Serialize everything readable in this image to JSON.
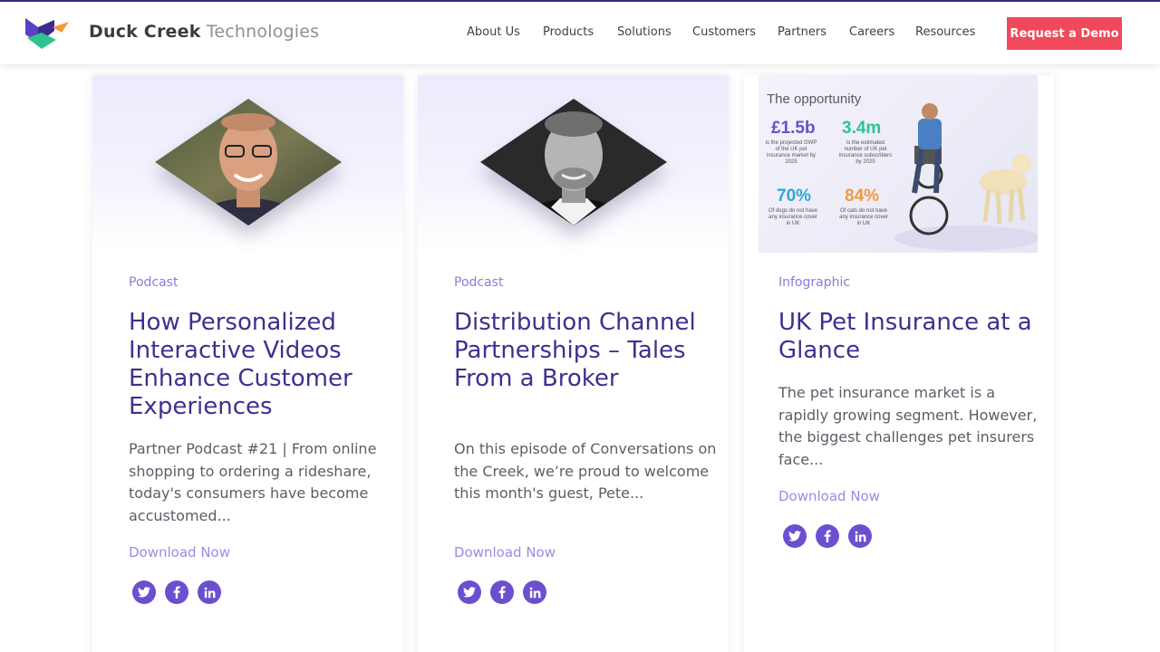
{
  "header": {
    "brand_main": "Duck Creek",
    "brand_sub": "Technologies",
    "nav": [
      "About Us",
      "Products",
      "Solutions",
      "Customers",
      "Partners",
      "Careers",
      "Resources"
    ],
    "cta": "Request a Demo"
  },
  "colors": {
    "accent": "#f0495a",
    "brand_purple": "#3d3190",
    "link": "#9a8de2",
    "social": "#6b4fcf"
  },
  "cards": [
    {
      "tag": "Podcast",
      "title": "How Personalized Interactive Videos Enhance Customer Experiences",
      "description": "Partner Podcast #21 | From online shopping to ordering a rideshare, today's consumers have become accustomed...",
      "link": "Download Now",
      "social": [
        "twitter-icon",
        "facebook-icon",
        "linkedin-icon"
      ]
    },
    {
      "tag": "Podcast",
      "title": "Distribution Channel Partnerships – Tales From a Broker",
      "description": "On this episode of Conversations on the Creek, we’re proud to welcome this month's guest, Pete...",
      "link": "Download Now",
      "social": [
        "twitter-icon",
        "facebook-icon",
        "linkedin-icon"
      ]
    },
    {
      "tag": "Infographic",
      "title": "UK Pet Insurance at a Glance",
      "description": "The pet insurance market is a rapidly growing segment. However, the biggest challenges pet insurers face...",
      "link": "Download Now",
      "social": [
        "twitter-icon",
        "facebook-icon",
        "linkedin-icon"
      ],
      "infographic": {
        "heading": "The opportunity",
        "stats": [
          {
            "value": "£1.5b",
            "text": "is the projected GWP of the UK pet insurance market by 2025",
            "color": "#6b4fcf"
          },
          {
            "value": "3.4m",
            "text": "is the estimated number of UK pet insurance subscribers by 2025",
            "color": "#2fc48e"
          },
          {
            "value": "70%",
            "text": "Of dogs do not have any insurance cover in UK",
            "color": "#2fa6d6"
          },
          {
            "value": "84%",
            "text": "Of cats do not have any insurance cover in UK",
            "color": "#f39a3c"
          }
        ]
      }
    }
  ]
}
